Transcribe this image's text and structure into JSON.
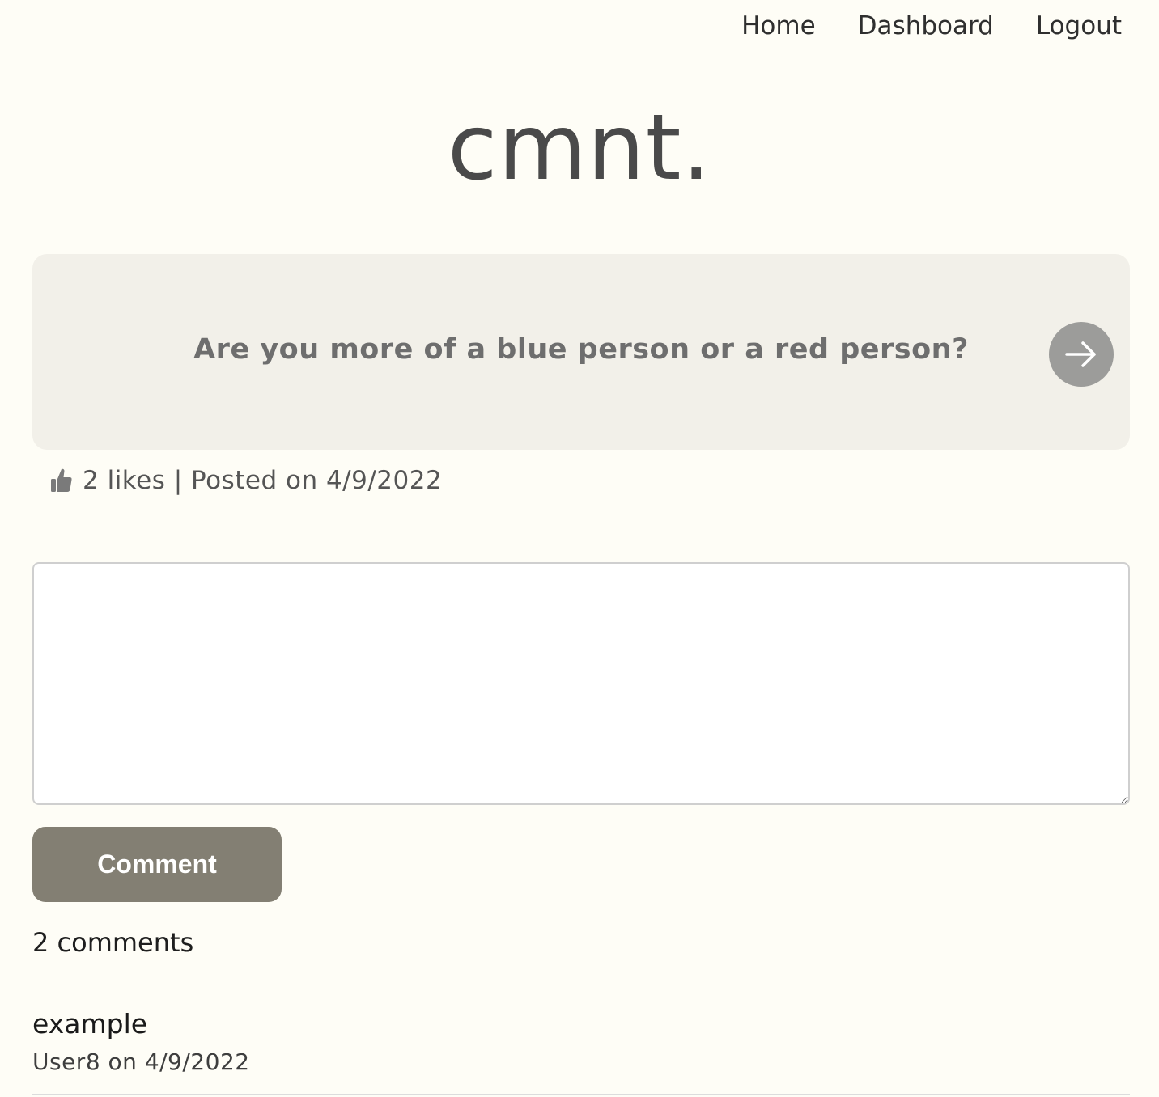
{
  "nav": {
    "home": "Home",
    "dashboard": "Dashboard",
    "logout": "Logout"
  },
  "logo": "cmnt.",
  "post": {
    "question": "Are you more of a blue person or a red person?",
    "meta": "2 likes | Posted on 4/9/2022",
    "like_icon": "thumbs-up-icon",
    "go_icon": "arrow-right-icon"
  },
  "comment_form": {
    "value": "",
    "button_label": "Comment"
  },
  "comments": {
    "count_label": "2 comments",
    "items": [
      {
        "body": "example",
        "meta": "User8 on 4/9/2022"
      }
    ]
  },
  "colors": {
    "background": "#fefdf6",
    "card": "#f2f0e9",
    "button": "#837f73",
    "arrow_circle": "#9c9c9a"
  }
}
